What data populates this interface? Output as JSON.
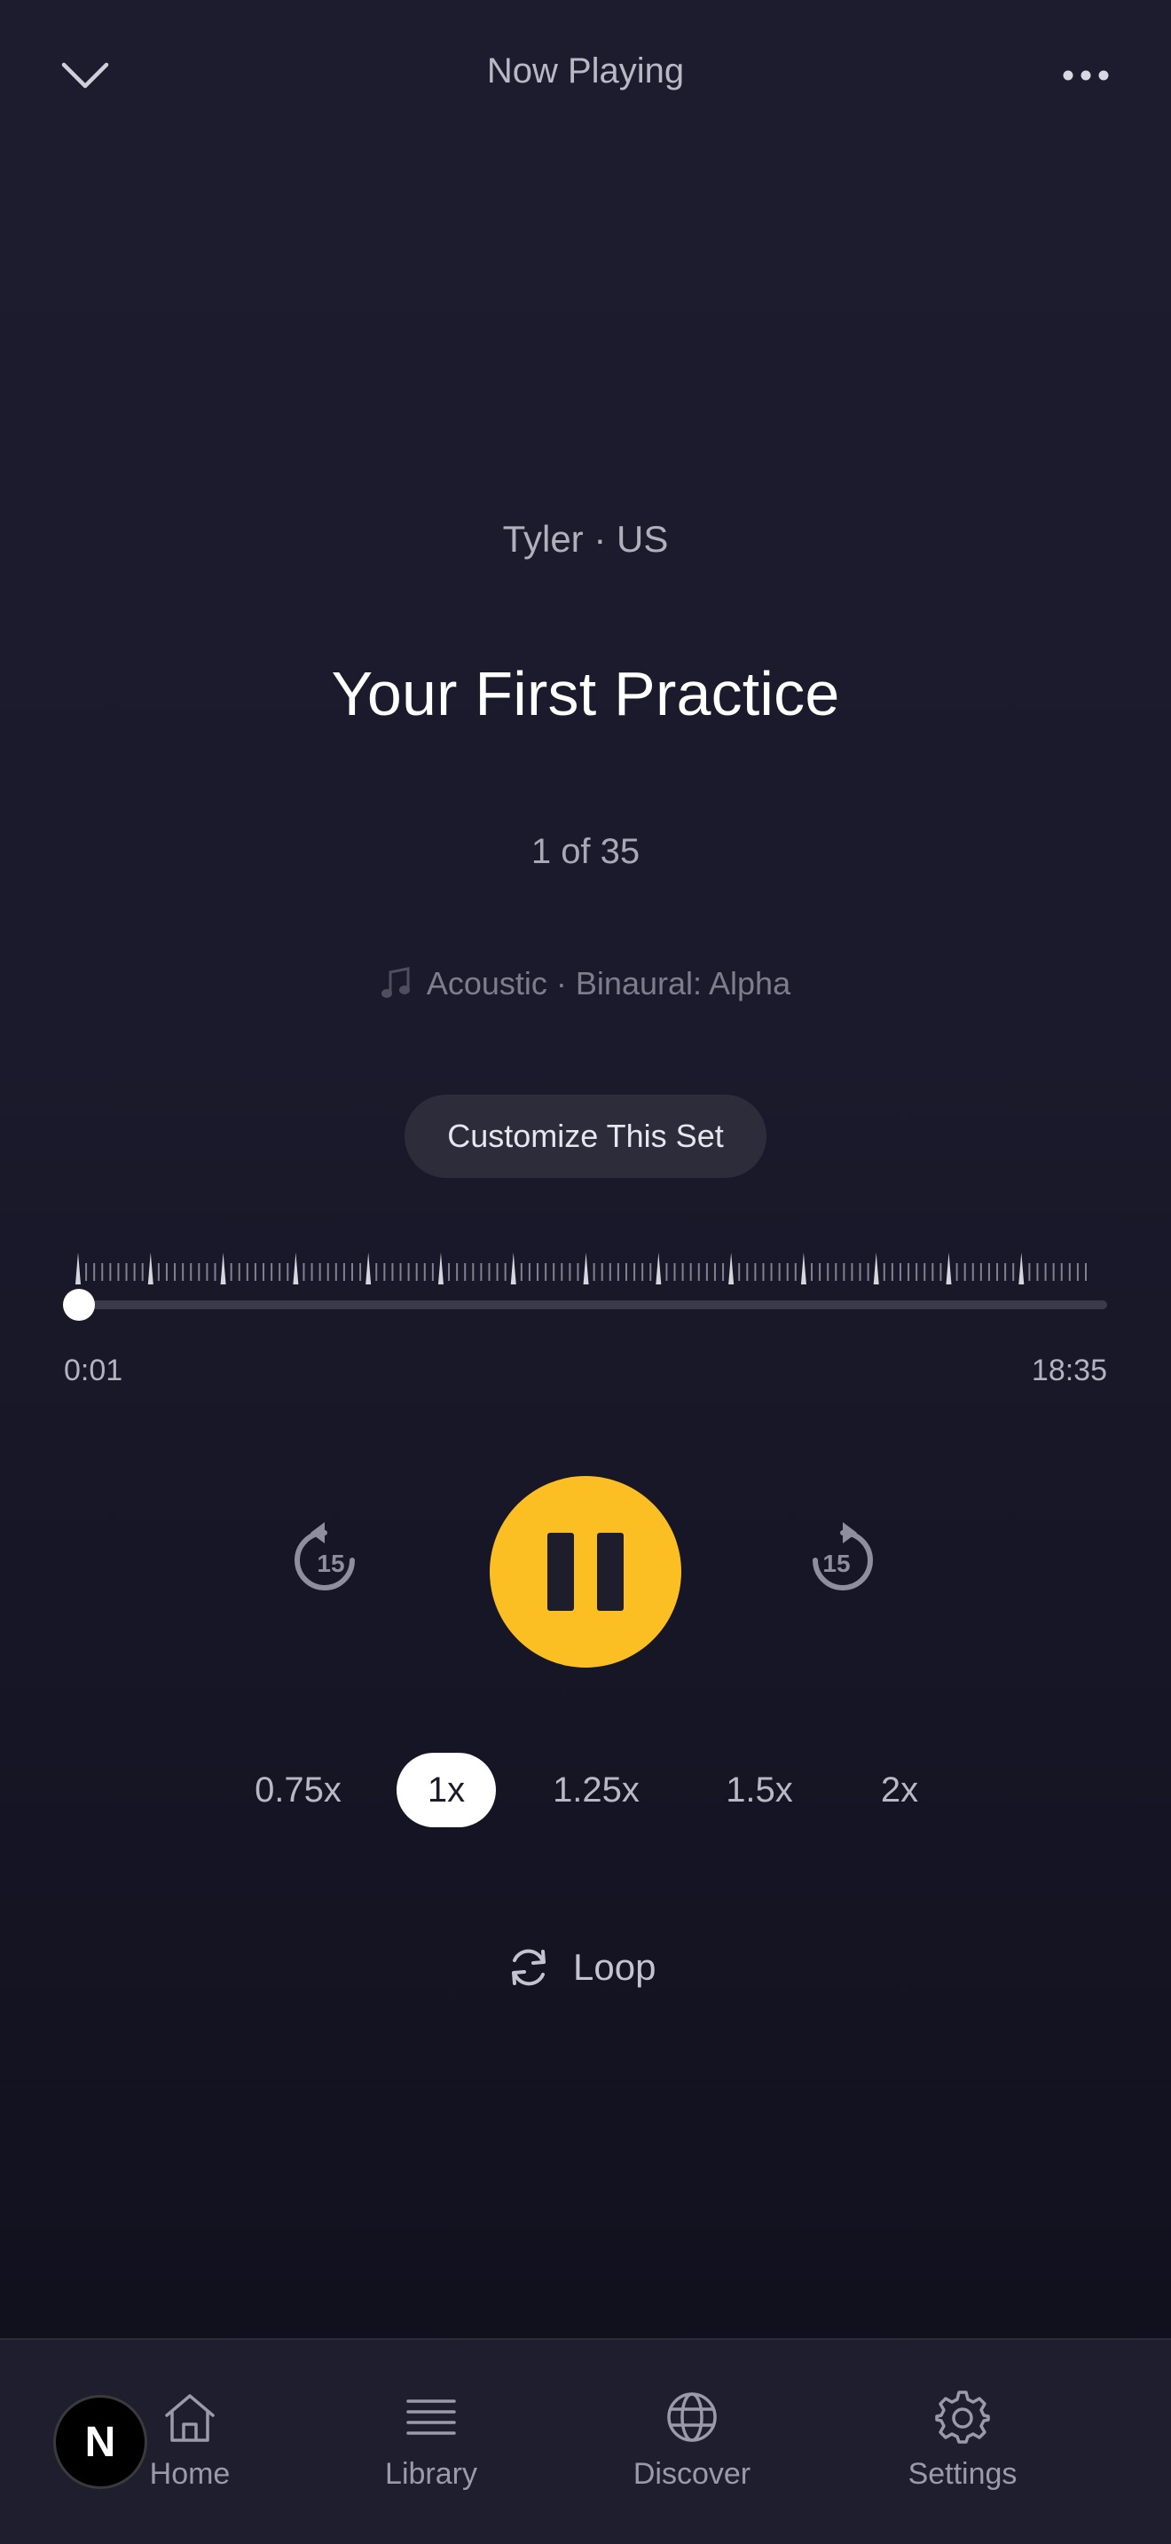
{
  "header": {
    "title": "Now Playing",
    "collapse_icon": "chevron-down-icon",
    "more_icon": "more-horizontal-icon"
  },
  "track": {
    "artist_line": "Tyler · US",
    "title": "Your First Practice",
    "counter": "1 of 35",
    "sound_line": "Acoustic · Binaural: Alpha",
    "sound_icon": "music-note-icon"
  },
  "customize_label": "Customize This Set",
  "playback": {
    "elapsed": "0:01",
    "total": "18:35",
    "progress_fraction": 0.001
  },
  "controls": {
    "rewind_label": "15",
    "forward_label": "15",
    "state": "playing",
    "accent_color": "#fbbf24"
  },
  "speeds": {
    "options": [
      "0.75x",
      "1x",
      "1.25x",
      "1.5x",
      "2x"
    ],
    "selected": "1x"
  },
  "loop_label": "Loop",
  "nav": {
    "items": [
      {
        "label": "Home",
        "icon": "home-icon"
      },
      {
        "label": "Library",
        "icon": "library-icon"
      },
      {
        "label": "Discover",
        "icon": "globe-icon"
      },
      {
        "label": "Settings",
        "icon": "gear-icon"
      }
    ]
  },
  "badge_letter": "N"
}
